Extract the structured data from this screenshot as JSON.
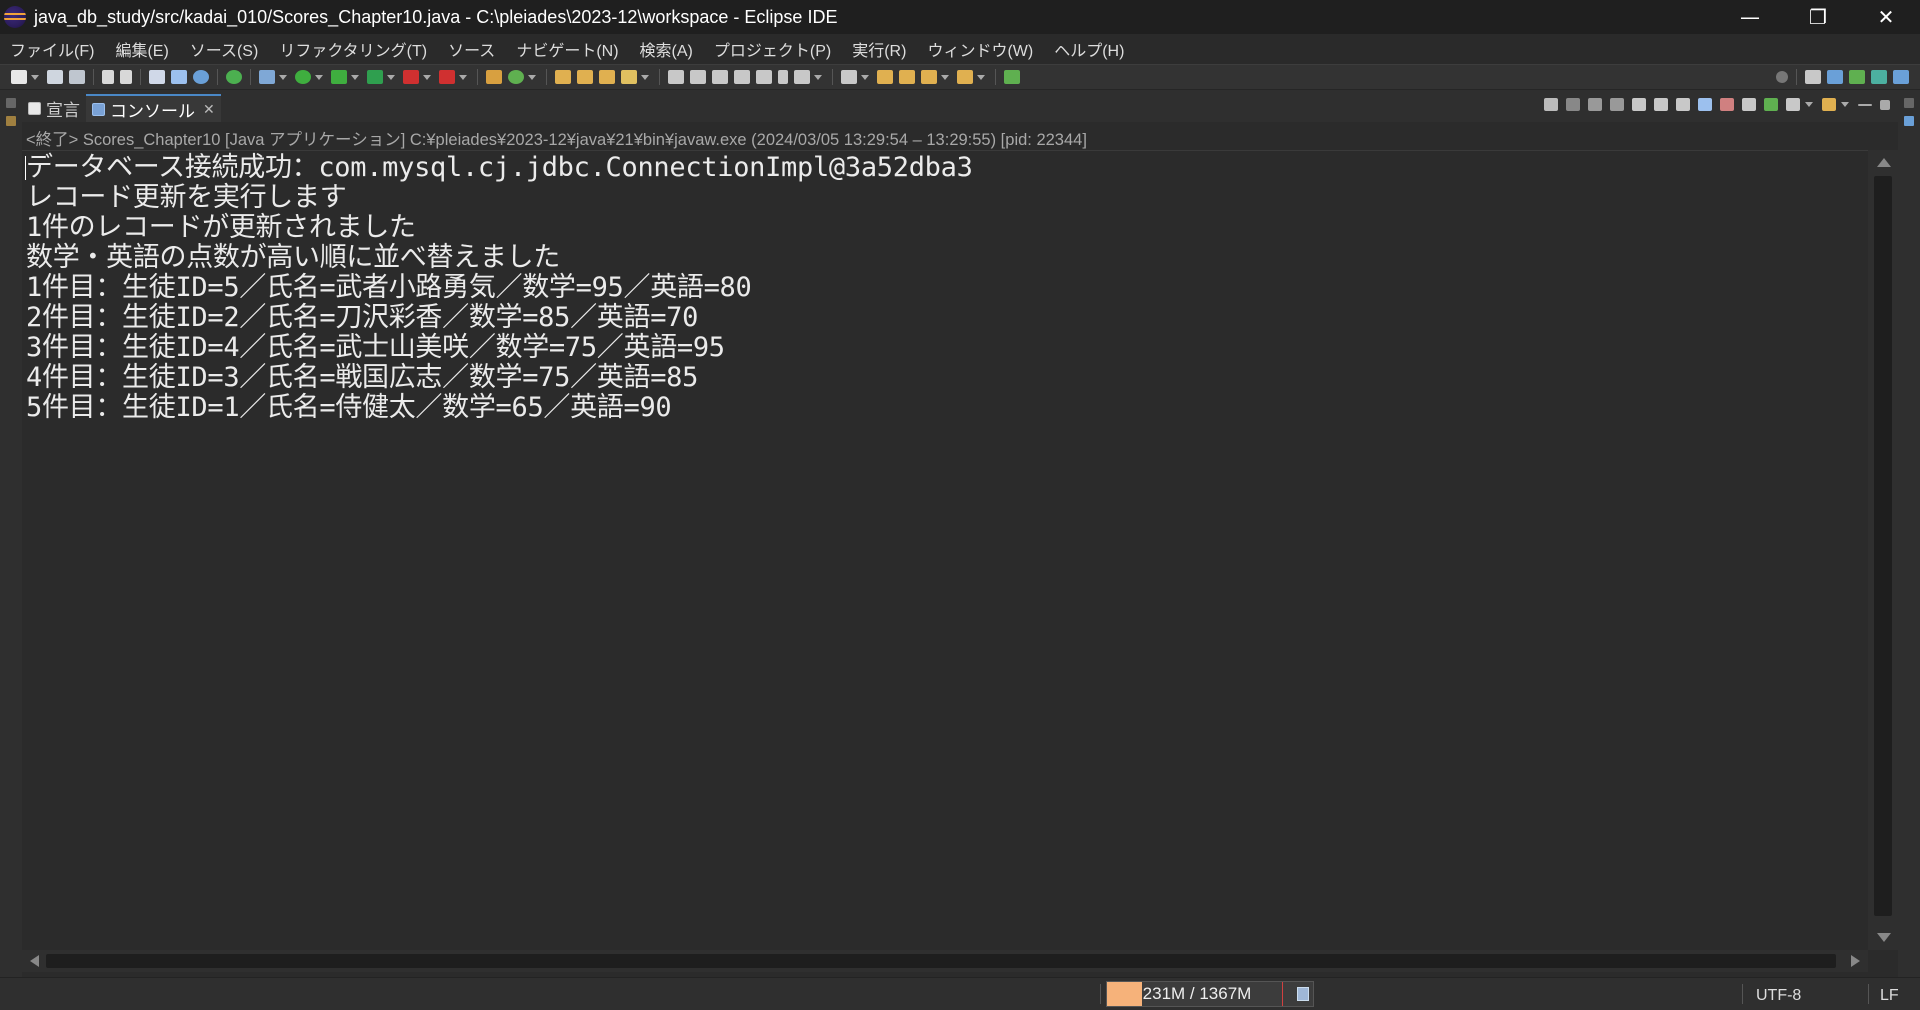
{
  "window": {
    "title": "java_db_study/src/kadai_010/Scores_Chapter10.java - C:\\pleiades\\2023-12\\workspace - Eclipse IDE",
    "controls": {
      "minimize": "—",
      "restore": "❐",
      "close": "✕"
    }
  },
  "menu": {
    "items": [
      "ファイル(F)",
      "編集(E)",
      "ソース(S)",
      "リファクタリング(T)",
      "ソース",
      "ナビゲート(N)",
      "検索(A)",
      "プロジェクト(P)",
      "実行(R)",
      "ウィンドウ(W)",
      "ヘルプ(H)"
    ]
  },
  "view": {
    "tabs": [
      {
        "label": "宣言",
        "icon": "declaration-icon",
        "active": false
      },
      {
        "label": "コンソール",
        "icon": "console-icon",
        "active": true,
        "close": "✕"
      }
    ],
    "console_label": "<終了> Scores_Chapter10 [Java アプリケーション] C:¥pleiades¥2023-12¥java¥21¥bin¥javaw.exe  (2024/03/05 13:29:54 – 13:29:55) [pid: 22344]",
    "lines": [
      "データベース接続成功：com.mysql.cj.jdbc.ConnectionImpl@3a52dba3",
      "レコード更新を実行します",
      "1件のレコードが更新されました",
      "数学・英語の点数が高い順に並べ替えました",
      "1件目：生徒ID=5／氏名=武者小路勇気／数学=95／英語=80",
      "2件目：生徒ID=2／氏名=刀沢彩香／数学=85／英語=70",
      "3件目：生徒ID=4／氏名=武士山美咲／数学=75／英語=95",
      "4件目：生徒ID=3／氏名=戦国広志／数学=75／英語=85",
      "5件目：生徒ID=1／氏名=侍健太／数学=65／英語=90"
    ]
  },
  "status": {
    "heap_text": "231M / 1367M",
    "heap_used_fraction": 0.17,
    "encoding": "UTF-8",
    "line_delimiter": "LF"
  },
  "colors": {
    "accent": "#4a88c7",
    "heap_fill": "#f6b27a"
  }
}
